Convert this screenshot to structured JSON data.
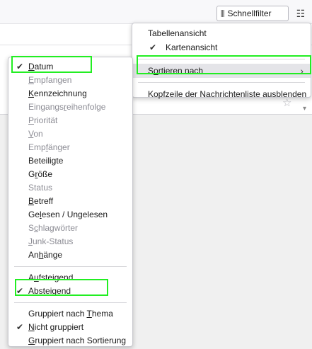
{
  "toolbar": {
    "quickfilter_label": "Schnellfilter",
    "quickfilter_icon": "filter-icon",
    "layout_icon": "sliders-icon"
  },
  "view_menu": {
    "items": [
      {
        "label": "Tabellenansicht",
        "checked": false
      },
      {
        "label": "Kartenansicht",
        "checked": true
      },
      {
        "label": "Sortieren nach",
        "submenu": true,
        "highlighted": true
      },
      {
        "label": "Kopfzeile der Nachrichtenliste ausblenden"
      }
    ]
  },
  "sort_menu": {
    "fields": [
      {
        "label": "Datum",
        "checked": true,
        "enabled": true
      },
      {
        "label": "Empfangen",
        "enabled": false
      },
      {
        "label": "Kennzeichnung",
        "enabled": true
      },
      {
        "label": "Eingangsreihenfolge",
        "enabled": false
      },
      {
        "label": "Priorität",
        "enabled": false
      },
      {
        "label": "Von",
        "enabled": false
      },
      {
        "label": "Empfänger",
        "enabled": false
      },
      {
        "label": "Beteiligte",
        "enabled": true
      },
      {
        "label": "Größe",
        "enabled": true
      },
      {
        "label": "Status",
        "enabled": false
      },
      {
        "label": "Betreff",
        "enabled": true
      },
      {
        "label": "Gelesen / Ungelesen",
        "enabled": true
      },
      {
        "label": "Schlagwörter",
        "enabled": false
      },
      {
        "label": "Junk-Status",
        "enabled": false
      },
      {
        "label": "Anhänge",
        "enabled": true
      }
    ],
    "order": [
      {
        "label": "Aufsteigend",
        "checked": false
      },
      {
        "label": "Absteigend",
        "checked": true
      }
    ],
    "grouping": [
      {
        "label": "Gruppiert nach Thema",
        "checked": false
      },
      {
        "label": "Nicht gruppiert",
        "checked": true
      },
      {
        "label": "Gruppiert nach Sortierung",
        "checked": false
      }
    ]
  },
  "colors": {
    "highlight_box": "#22ee22",
    "disabled_text": "#8c8c94",
    "hover_bg": "#e4e4e8"
  }
}
